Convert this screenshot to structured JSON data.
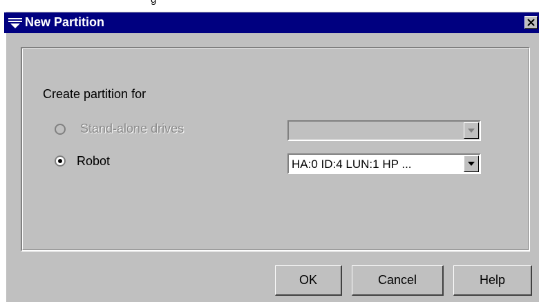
{
  "window": {
    "title": "New Partition",
    "top_text": "g"
  },
  "form": {
    "group_label": "Create partition for",
    "options": [
      {
        "label": "Stand-alone drives",
        "selected": false,
        "enabled": false
      },
      {
        "label": "Robot",
        "selected": true,
        "enabled": true
      }
    ],
    "standalone_combo_value": "",
    "robot_combo_value": "HA:0 ID:4 LUN:1 HP ..."
  },
  "buttons": {
    "ok": "OK",
    "cancel": "Cancel",
    "help": "Help"
  },
  "colors": {
    "titlebar": "#000080",
    "face": "#c0c0c0"
  },
  "icons": {
    "window_menu": "window-menu-icon",
    "close": "close-icon",
    "dropdown": "chevron-down-icon"
  }
}
